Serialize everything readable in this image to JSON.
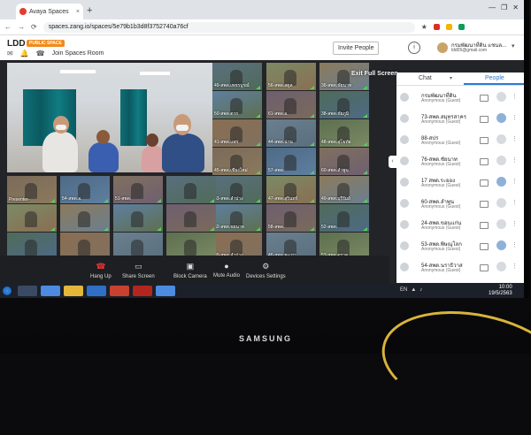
{
  "browser": {
    "tab_title": "Avaya Spaces",
    "tab_close": "×",
    "new_tab": "+",
    "url": "spaces.zang.io/spaces/5e79b1b3d8f3752740a76cf"
  },
  "app_header": {
    "space_name": "LDD",
    "badge": "PUBLIC SPACE",
    "join_link": "Join Spaces Room",
    "invite_button": "Invite People",
    "info_glyph": "i",
    "user_name": "กรมพัฒนาที่ดิน แชนล...",
    "user_email": "ldd05@gmail.com"
  },
  "meeting": {
    "exit_fullscreen": "Exit Full Screen",
    "tiles": [
      "49-สพด.เพชรบูรณ์",
      "56-สพด.สตูล",
      "36-สพด.ชัยนาท",
      "50-สพด.ตาก",
      "61-สพด.อ.",
      "38-สพด.ชัยภูมิ",
      "41-สพด.แพร่",
      "44-สพด.น่าน",
      "48-สพด.สุโขทัย",
      "45-สพด.เชียงใหม่",
      "57-สพด.",
      "60-สพด.ลำพูน",
      "43-สพด.ลำปาง",
      "47-สพด.สุรินทร์",
      "40-สพด.บุรีรัมย์",
      "62-สพด.ชยนาท",
      "58-สพด.",
      "52-สพด.",
      "39-สพด.ลำปาง",
      "46-สพด.พะเยา",
      "53-สพด.ตราด",
      "Presenter-",
      "54-สพด.อ.",
      "51-สพด."
    ],
    "controls": {
      "hangup": "Hang Up",
      "share": "Share Screen",
      "camera": "Block Camera",
      "audio": "Mute Audio",
      "settings": "Devices Settings"
    }
  },
  "panel": {
    "chat_tab": "Chat",
    "people_tab": "People",
    "people": [
      {
        "name": "กรมพัฒนาที่ดิน",
        "role": "Anonymous (Guest)"
      },
      {
        "name": "73-สพด.สมุทรสาคร",
        "role": "Anonymous (Guest)"
      },
      {
        "name": "88-สปร",
        "role": "Anonymous (Guest)"
      },
      {
        "name": "76-สพด.ชัยนาท",
        "role": "Anonymous (Guest)"
      },
      {
        "name": "17 สพด.ระยอง",
        "role": "Anonymous (Guest)"
      },
      {
        "name": "60-สพด.ลำพูน",
        "role": "Anonymous (Guest)"
      },
      {
        "name": "24-สพด.ขอนแก่น",
        "role": "Anonymous (Guest)"
      },
      {
        "name": "53-สพด.พิษณุโลก",
        "role": "Anonymous (Guest)"
      },
      {
        "name": "54-สพด.นราธิวาส",
        "role": "Anonymous (Guest)"
      }
    ]
  },
  "taskbar": {
    "lang": "EN",
    "time": "10:00",
    "date": "19/5/2563"
  },
  "monitor_brand": "SAMSUNG",
  "colors": {
    "accent_blue": "#2a7ad6",
    "badge_orange": "#f08a1c",
    "hangup_red": "#e53935",
    "curtain_teal": "#0e6f76"
  }
}
